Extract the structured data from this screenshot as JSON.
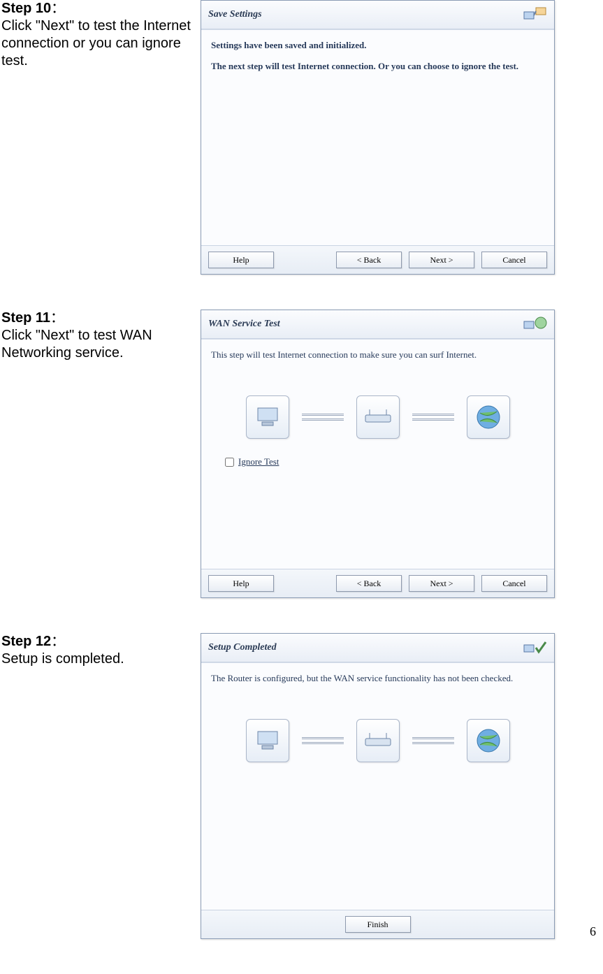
{
  "page_number": "6",
  "steps": [
    {
      "label": "Step 10",
      "colon": "：",
      "desc": "Click \"Next\" to test the Internet connection or you can ignore test.",
      "dialog": {
        "title": "Save Settings",
        "body_lines": [
          "Settings have been saved and initialized.",
          "The next step will test Internet connection. Or you can choose to ignore the test."
        ],
        "buttons": {
          "help": "Help",
          "back": "< Back",
          "next": "Next >",
          "cancel": "Cancel"
        }
      }
    },
    {
      "label": "Step 11",
      "colon": "：",
      "desc": "Click \"Next\" to test WAN Networking service.",
      "dialog": {
        "title": "WAN Service Test",
        "body_lines": [
          "This step will test Internet connection to make sure you can surf Internet."
        ],
        "ignore_label": "Ignore Test",
        "buttons": {
          "help": "Help",
          "back": "< Back",
          "next": "Next >",
          "cancel": "Cancel"
        }
      }
    },
    {
      "label": "Step 12",
      "colon": "：",
      "desc": "Setup is completed.",
      "dialog": {
        "title": "Setup Completed",
        "body_lines": [
          "The Router is configured, but the WAN service functionality has not been checked."
        ],
        "buttons": {
          "finish": "Finish"
        }
      }
    }
  ]
}
